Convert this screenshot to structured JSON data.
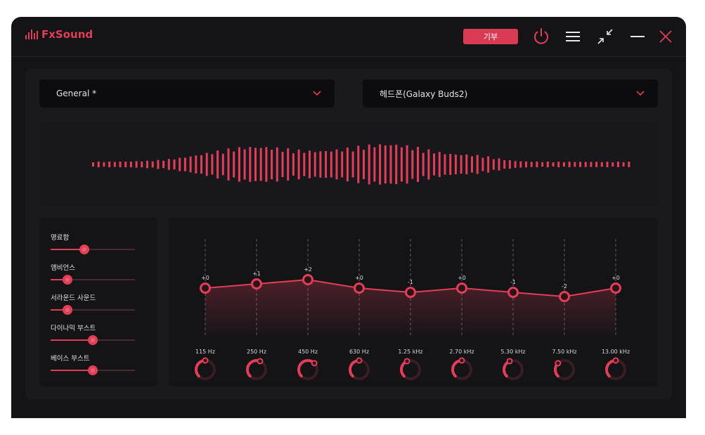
{
  "app": {
    "name": "FxSound",
    "donate_label": "기부"
  },
  "colors": {
    "accent": "#e23e57",
    "window_bg": "#141417",
    "panel_bg": "#1a1a1e"
  },
  "titlebar_icons": [
    "power-icon",
    "menu-icon",
    "shrink-icon",
    "minimize-icon",
    "close-icon"
  ],
  "preset": {
    "value": "General *"
  },
  "output_device": {
    "value": "헤드폰(Galaxy Buds2)"
  },
  "effects": [
    {
      "label": "명료함",
      "value": 0.4
    },
    {
      "label": "앰비언스",
      "value": 0.2
    },
    {
      "label": "서라운드 사운드",
      "value": 0.2
    },
    {
      "label": "다이나믹 부스트",
      "value": 0.5
    },
    {
      "label": "베이스 부스트",
      "value": 0.5
    }
  ],
  "equalizer": {
    "bands": [
      {
        "freq": "115 Hz",
        "gain": 0,
        "gain_label": "+0"
      },
      {
        "freq": "250 Hz",
        "gain": 1,
        "gain_label": "+1"
      },
      {
        "freq": "450 Hz",
        "gain": 2,
        "gain_label": "+2"
      },
      {
        "freq": "630 Hz",
        "gain": 0,
        "gain_label": "+0"
      },
      {
        "freq": "1.25 kHz",
        "gain": -1,
        "gain_label": "-1"
      },
      {
        "freq": "2.70 kHz",
        "gain": 0,
        "gain_label": "+0"
      },
      {
        "freq": "5.30 kHz",
        "gain": -1,
        "gain_label": "-1"
      },
      {
        "freq": "7.50 kHz",
        "gain": -2,
        "gain_label": "-2"
      },
      {
        "freq": "13.00 kHz",
        "gain": 0,
        "gain_label": "+0"
      }
    ]
  }
}
